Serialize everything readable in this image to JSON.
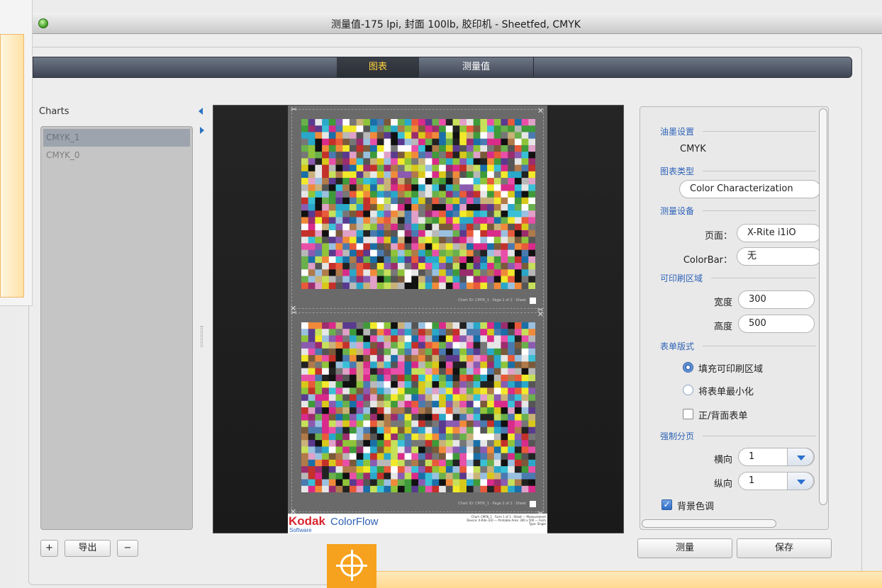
{
  "window": {
    "title": "测量值-175 lpi, 封面 100lb, 胶印机 - Sheetfed, CMYK"
  },
  "tabs": [
    {
      "label": "图表",
      "active": true
    },
    {
      "label": "测量值",
      "active": false
    }
  ],
  "sidebar": {
    "heading": "Charts",
    "items": [
      {
        "label": "CMYK_1",
        "selected": true
      },
      {
        "label": "CMYK_0",
        "selected": false
      }
    ],
    "add_label": "+",
    "export_label": "导出",
    "remove_label": "−"
  },
  "preview": {
    "sheet1_caption": "Chart ID: CMYK_1 · Page 1 of 2 · Sheet",
    "sheet2_caption": "Chart ID: CMYK_1 · Page 2 of 2 · Sheet",
    "brand": "Kodak",
    "product": "ColorFlow",
    "tagline": "Software",
    "fine_print": "Chart: CMYK_1 · Form 1 of 1 · Sheet — Measurement Device: X-Rite i1iO — Printable Area: 300 x 500 — Form Type: Single"
  },
  "settings": {
    "ink_setup": {
      "label": "油墨设置",
      "value": "CMYK"
    },
    "chart_type": {
      "label": "图表类型",
      "value": "Color Characterization"
    },
    "device": {
      "label": "测量设备",
      "page_label": "页面：",
      "page_value": "X-Rite i1iO",
      "colorbar_label": "ColorBar：",
      "colorbar_value": "无"
    },
    "printable_area": {
      "label": "可印刷区域",
      "width_label": "宽度",
      "width_value": "300",
      "height_label": "高度",
      "height_value": "500"
    },
    "form_layout": {
      "label": "表单版式",
      "fill_option": "填充可印刷区域",
      "fill_selected": true,
      "minimize_option": "将表单最小化",
      "minimize_selected": false,
      "front_back_option": "正/背面表单",
      "front_back_checked": false
    },
    "force_paging": {
      "label": "强制分页",
      "horizontal_label": "横向",
      "horizontal_value": "1",
      "vertical_label": "纵向",
      "vertical_value": "1"
    },
    "background_tint": {
      "label": "背景色调",
      "checked": true
    }
  },
  "actions": {
    "measure_label": "测量",
    "save_label": "保存"
  },
  "colors": {
    "accent_tab_text": "#ffd23c",
    "section_label": "#2f63b7",
    "target_overlay": "#f7a21e",
    "kodak_red": "#d8262d",
    "colorflow_blue": "#2e61b5"
  }
}
